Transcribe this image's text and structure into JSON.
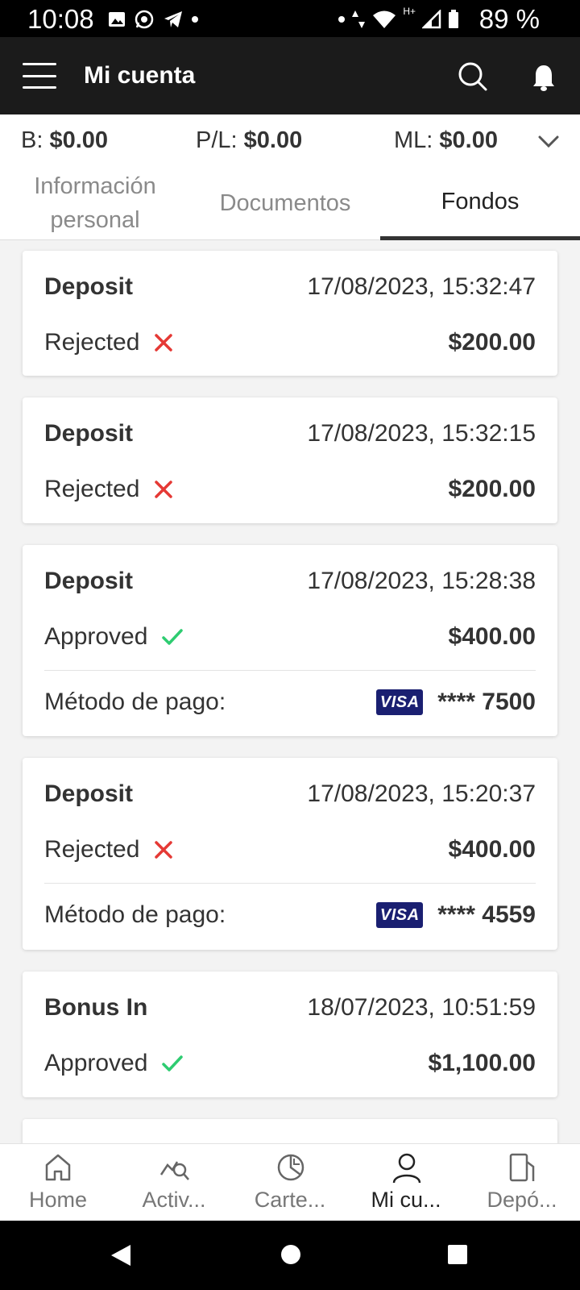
{
  "status_bar": {
    "time": "10:08",
    "battery": "89 %",
    "network": "H+"
  },
  "header": {
    "title": "Mi cuenta"
  },
  "summary": {
    "balance_label": "B:",
    "balance_value": "$0.00",
    "pl_label": "P/L:",
    "pl_value": "$0.00",
    "ml_label": "ML:",
    "ml_value": "$0.00"
  },
  "tabs": [
    {
      "label": "Información personal"
    },
    {
      "label": "Documentos"
    },
    {
      "label": "Fondos",
      "active": true
    }
  ],
  "transactions": [
    {
      "type": "Deposit",
      "date": "17/08/2023, 15:32:47",
      "status": "Rejected",
      "amount": "$200.00"
    },
    {
      "type": "Deposit",
      "date": "17/08/2023, 15:32:15",
      "status": "Rejected",
      "amount": "$200.00"
    },
    {
      "type": "Deposit",
      "date": "17/08/2023, 15:28:38",
      "status": "Approved",
      "amount": "$400.00",
      "payment_label": "Método de pago:",
      "card_brand": "VISA",
      "card_number": "**** 7500"
    },
    {
      "type": "Deposit",
      "date": "17/08/2023, 15:20:37",
      "status": "Rejected",
      "amount": "$400.00",
      "payment_label": "Método de pago:",
      "card_brand": "VISA",
      "card_number": "**** 4559"
    },
    {
      "type": "Bonus In",
      "date": "18/07/2023, 10:51:59",
      "status": "Approved",
      "amount": "$1,100.00"
    }
  ],
  "bottom_nav": [
    {
      "label": "Home",
      "icon": "home-icon"
    },
    {
      "label": "Activ...",
      "icon": "chart-search-icon"
    },
    {
      "label": "Carte...",
      "icon": "pie-chart-icon"
    },
    {
      "label": "Mi cu...",
      "icon": "user-icon",
      "active": true
    },
    {
      "label": "Depó...",
      "icon": "deposit-icon"
    }
  ],
  "colors": {
    "rejected": "#e53935",
    "approved": "#2ecc71",
    "header_bg": "#1b1b1b",
    "visa": "#1a1f71"
  }
}
